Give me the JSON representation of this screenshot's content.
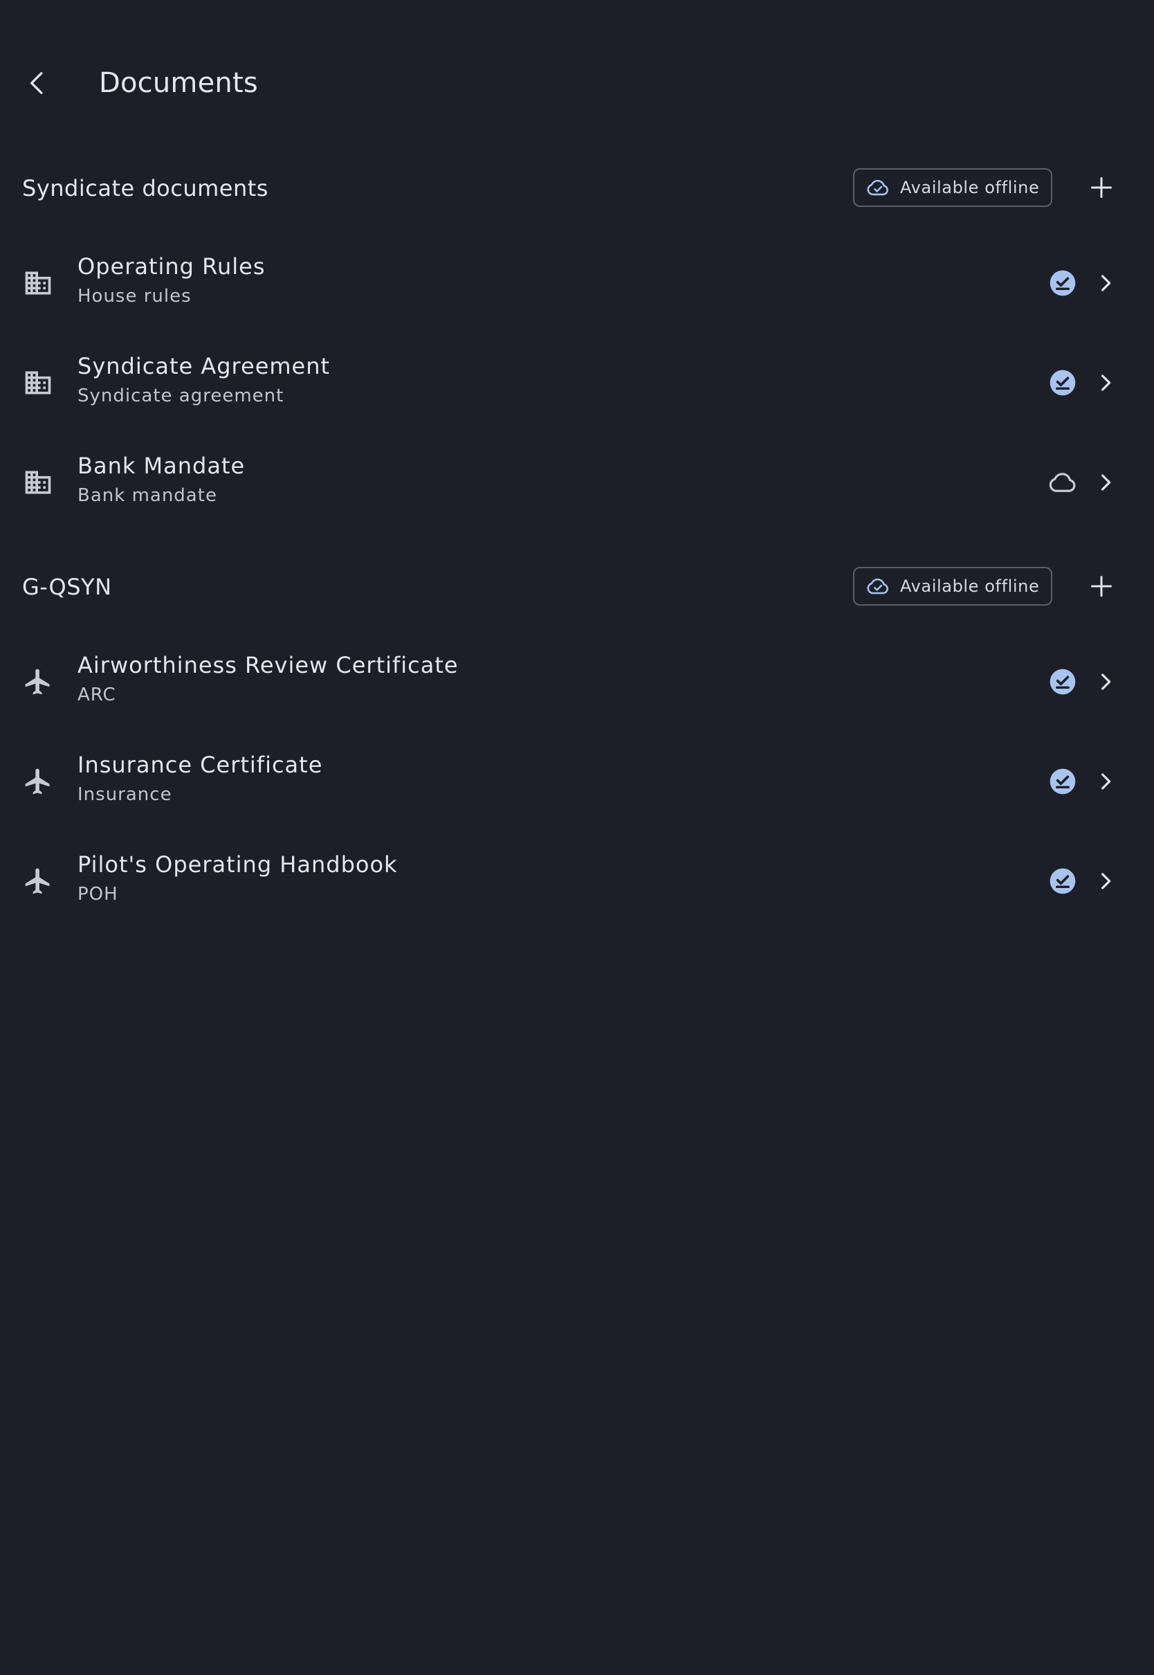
{
  "header": {
    "title": "Documents",
    "back_icon": "chevron-left-icon"
  },
  "colors": {
    "background": "#1c1f28",
    "accent": "#a8c3ef",
    "text": "#e6e6ee",
    "subtext": "#c3c4cc",
    "chip_border": "#5c5f6b"
  },
  "sections": [
    {
      "title": "Syndicate documents",
      "offline_label": "Available offline",
      "items": [
        {
          "title": "Operating Rules",
          "subtitle": "House rules",
          "icon": "building-icon",
          "status": "downloaded"
        },
        {
          "title": "Syndicate Agreement",
          "subtitle": "Syndicate agreement",
          "icon": "building-icon",
          "status": "downloaded"
        },
        {
          "title": "Bank Mandate",
          "subtitle": "Bank mandate",
          "icon": "building-icon",
          "status": "cloud"
        }
      ]
    },
    {
      "title": "G-QSYN",
      "offline_label": "Available offline",
      "items": [
        {
          "title": "Airworthiness Review Certificate",
          "subtitle": "ARC",
          "icon": "airplane-icon",
          "status": "downloaded"
        },
        {
          "title": "Insurance Certificate",
          "subtitle": "Insurance",
          "icon": "airplane-icon",
          "status": "downloaded"
        },
        {
          "title": "Pilot's Operating Handbook",
          "subtitle": "POH",
          "icon": "airplane-icon",
          "status": "downloaded"
        }
      ]
    }
  ]
}
